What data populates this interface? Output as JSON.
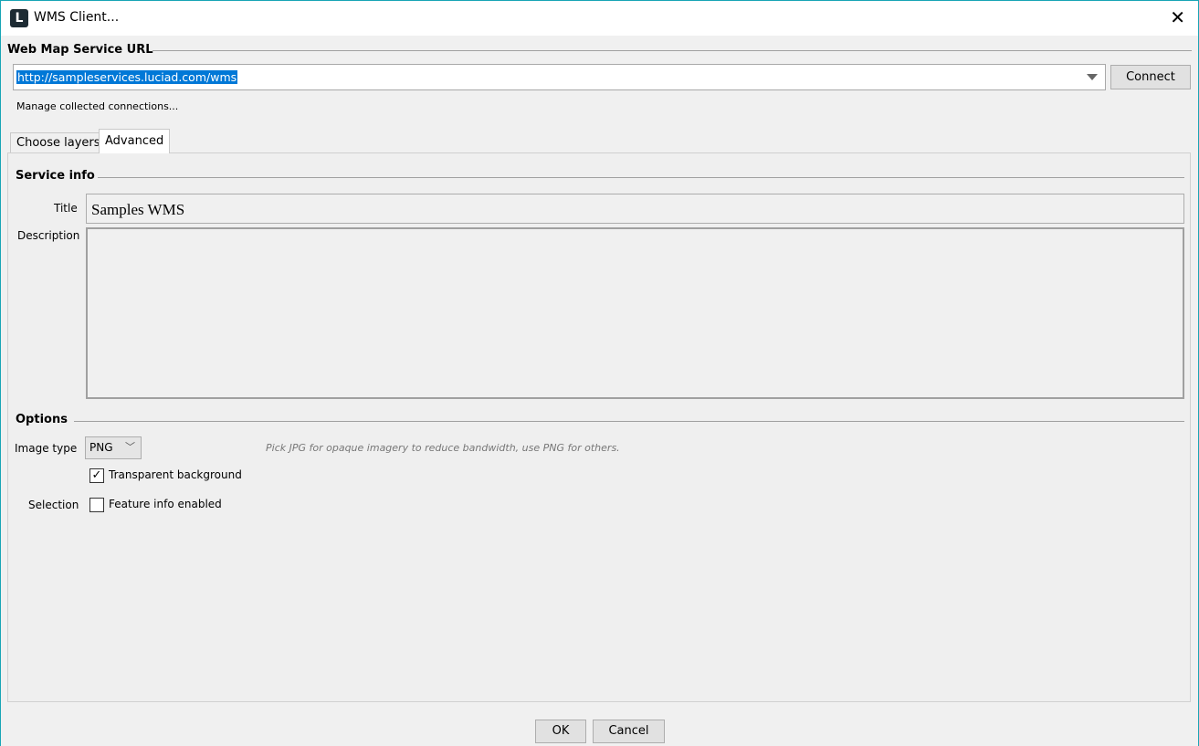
{
  "window": {
    "title": "WMS Client...",
    "logo_letter": "L",
    "close": "✕"
  },
  "url_section": {
    "heading": "Web Map Service URL",
    "url": "http://sampleservices.luciad.com/wms",
    "connect": "Connect",
    "manage": "Manage collected connections..."
  },
  "tabs": [
    {
      "label": "Choose layers",
      "active": false
    },
    {
      "label": "Advanced",
      "active": true
    }
  ],
  "service_info": {
    "heading": "Service info",
    "title_label": "Title",
    "title_value": "Samples WMS",
    "description_label": "Description",
    "description_value": ""
  },
  "options": {
    "heading": "Options",
    "image_type_label": "Image type",
    "image_type_value": "PNG",
    "hint": "Pick JPG for opaque imagery to reduce bandwidth, use PNG for others.",
    "transparent_label": "Transparent background",
    "transparent_checked": true,
    "selection_label": "Selection",
    "feature_info_label": "Feature info enabled",
    "feature_info_checked": false
  },
  "footer": {
    "ok": "OK",
    "cancel": "Cancel"
  }
}
